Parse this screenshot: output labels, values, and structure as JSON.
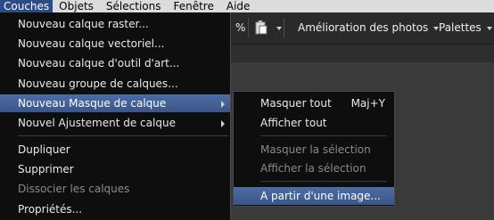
{
  "menubar": {
    "items": [
      {
        "label": "Couches",
        "active": true
      },
      {
        "label": "Objets"
      },
      {
        "label": "Sélections"
      },
      {
        "label": "Fenêtre"
      },
      {
        "label": "Aide"
      }
    ]
  },
  "toolbar": {
    "percent_label": "%",
    "paste_icon": "clipboard-icon",
    "photo_fix_label": "Amélioration des photos",
    "palettes_label": "Palettes"
  },
  "main_menu": {
    "items": [
      {
        "label": "Nouveau calque raster..."
      },
      {
        "label": "Nouveau calque vectoriel..."
      },
      {
        "label": "Nouveau calque d'outil d'art..."
      },
      {
        "label": "Nouveau groupe de calques..."
      },
      {
        "label": "Nouveau Masque de calque",
        "submenu": true,
        "highlighted": true
      },
      {
        "label": "Nouvel Ajustement de calque",
        "submenu": true
      },
      {
        "label": "Dupliquer"
      },
      {
        "label": "Supprimer"
      },
      {
        "label": "Dissocier les calques",
        "disabled": true
      },
      {
        "label": "Propriétés..."
      }
    ]
  },
  "submenu": {
    "items": [
      {
        "label": "Masquer tout",
        "shortcut": "Maj+Y"
      },
      {
        "label": "Afficher tout"
      },
      {
        "label": "Masquer la sélection",
        "disabled": true
      },
      {
        "label": "Afficher la sélection",
        "disabled": true
      },
      {
        "label": "A partir d'une image...",
        "highlighted": true
      }
    ]
  },
  "colors": {
    "menu_bg": "#0e0e0e",
    "highlight": "#3b5688",
    "menubar_bg": "#dcdcdc",
    "menubar_active": "#2c4b87",
    "disabled_text": "#8a8a8a"
  }
}
